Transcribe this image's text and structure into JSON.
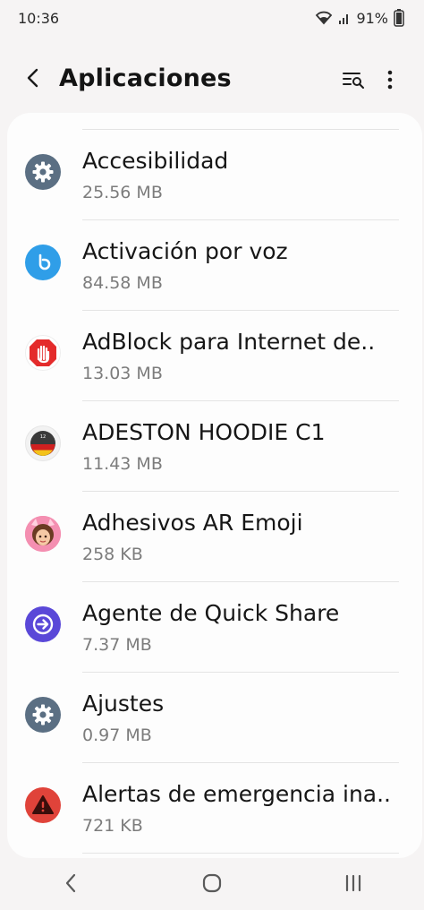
{
  "status_bar": {
    "time": "10:36",
    "battery": "91%",
    "icons": [
      "wifi-icon",
      "signal-icon"
    ]
  },
  "app_bar": {
    "title": "Aplicaciones",
    "icons": [
      "back-icon",
      "filter-search-icon",
      "more-vert-icon"
    ]
  },
  "apps": [
    {
      "name": "Accesibilidad",
      "size": "25.56 MB",
      "icon": "gear-icon",
      "color": "#5b6f83"
    },
    {
      "name": "Activación por voz",
      "size": "84.58 MB",
      "icon": "bixby-icon",
      "color": "#2f9ee8"
    },
    {
      "name": "AdBlock para Internet de..",
      "size": "13.03 MB",
      "icon": "adblock-hand-icon",
      "color": "#e42b2b"
    },
    {
      "name": "ADESTON HOODIE C1",
      "size": "11.43 MB",
      "icon": "watchface-icon",
      "color": "#d02020"
    },
    {
      "name": "Adhesivos AR Emoji",
      "size": "258 KB",
      "icon": "ar-emoji-avatar-icon",
      "color": "#f06a9a"
    },
    {
      "name": "Agente de Quick Share",
      "size": "7.37 MB",
      "icon": "quick-share-icon",
      "color": "#5a48d8"
    },
    {
      "name": "Ajustes",
      "size": "0.97 MB",
      "icon": "gear-icon",
      "color": "#5b6f83"
    },
    {
      "name": "Alertas de emergencia ina..",
      "size": "721 KB",
      "icon": "warning-icon",
      "color": "#e0433a"
    }
  ],
  "nav_bar": {
    "icons": [
      "nav-back-icon",
      "nav-home-icon",
      "nav-recents-icon"
    ]
  }
}
